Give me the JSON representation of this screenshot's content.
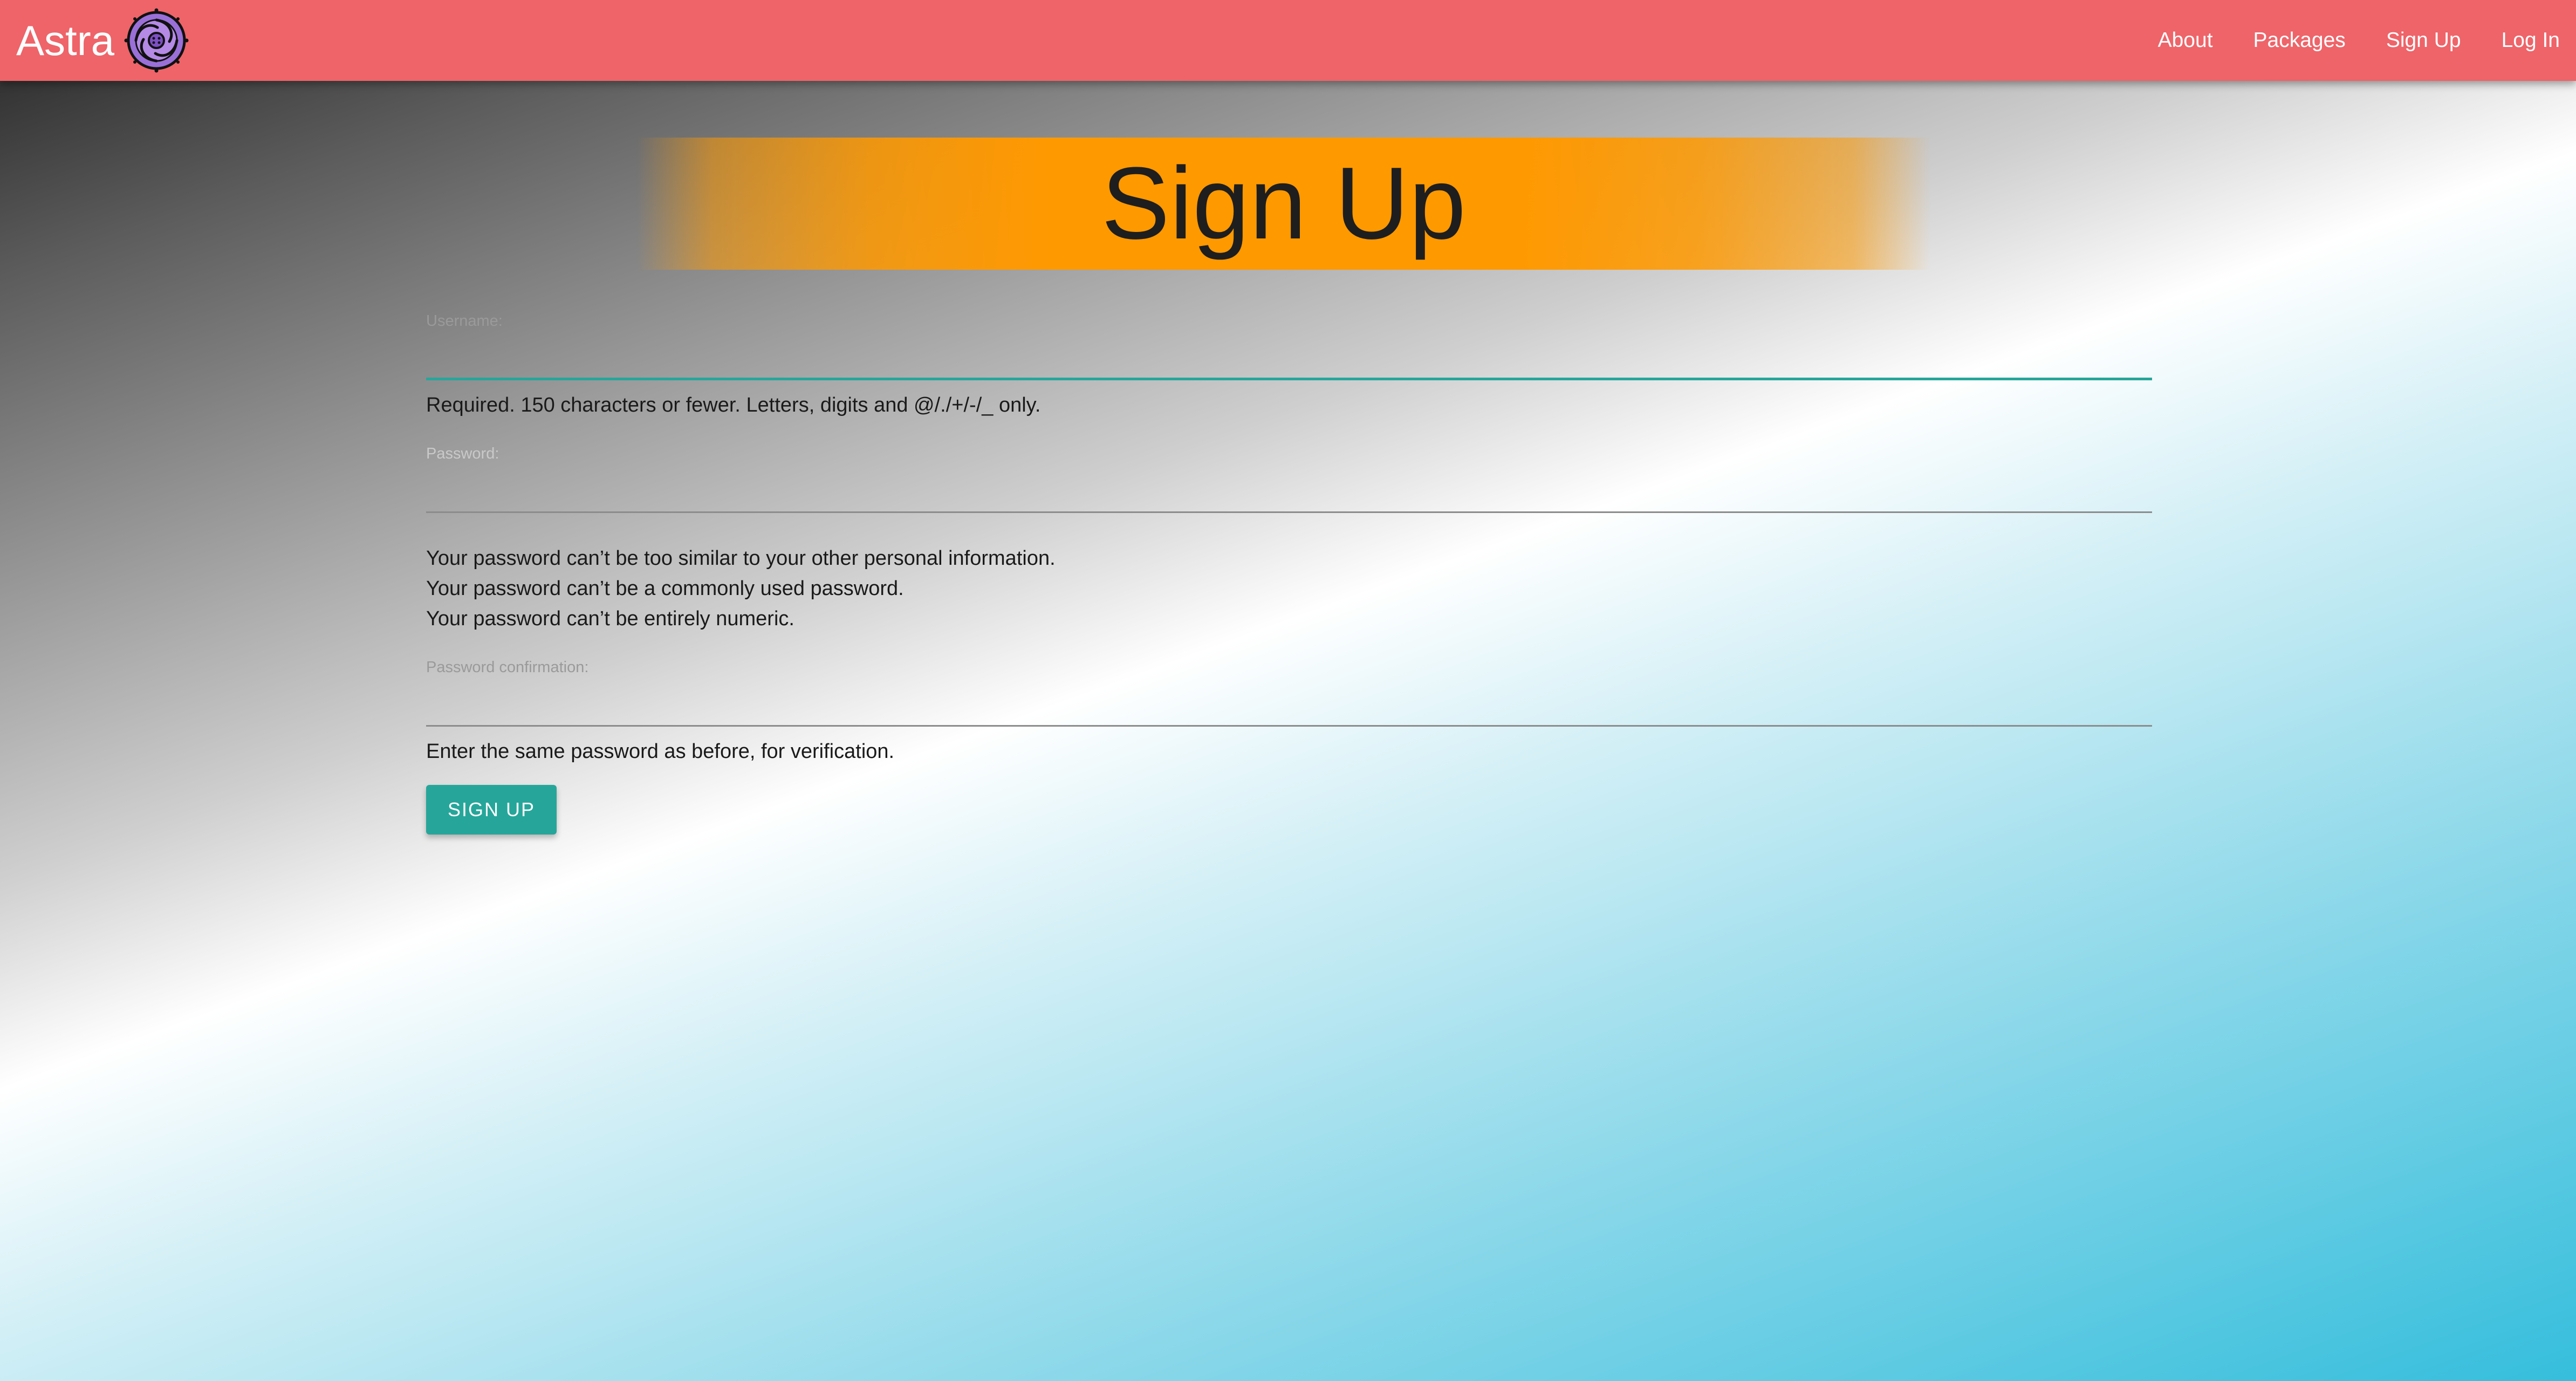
{
  "navbar": {
    "brand": "Astra",
    "links": [
      "About",
      "Packages",
      "Sign Up",
      "Log In"
    ],
    "background_color": "#ee6469"
  },
  "banner": {
    "title": "Sign Up",
    "color": "#ff9900"
  },
  "form": {
    "username": {
      "label": "Username:",
      "value": "",
      "help": "Required. 150 characters or fewer. Letters, digits and @/./+/-/_ only."
    },
    "password": {
      "label": "Password:",
      "value": "",
      "help": [
        "Your password can’t be too similar to your other personal information.",
        "Your password can’t be a commonly used password.",
        "Your password can’t be entirely numeric."
      ]
    },
    "password_confirmation": {
      "label": "Password confirmation:",
      "value": "",
      "help": "Enter the same password as before, for verification."
    },
    "submit_label": "SIGN UP",
    "accent_color": "#26a69a"
  },
  "icons": {
    "brand_logo": "astra-spiral-logo-icon"
  }
}
